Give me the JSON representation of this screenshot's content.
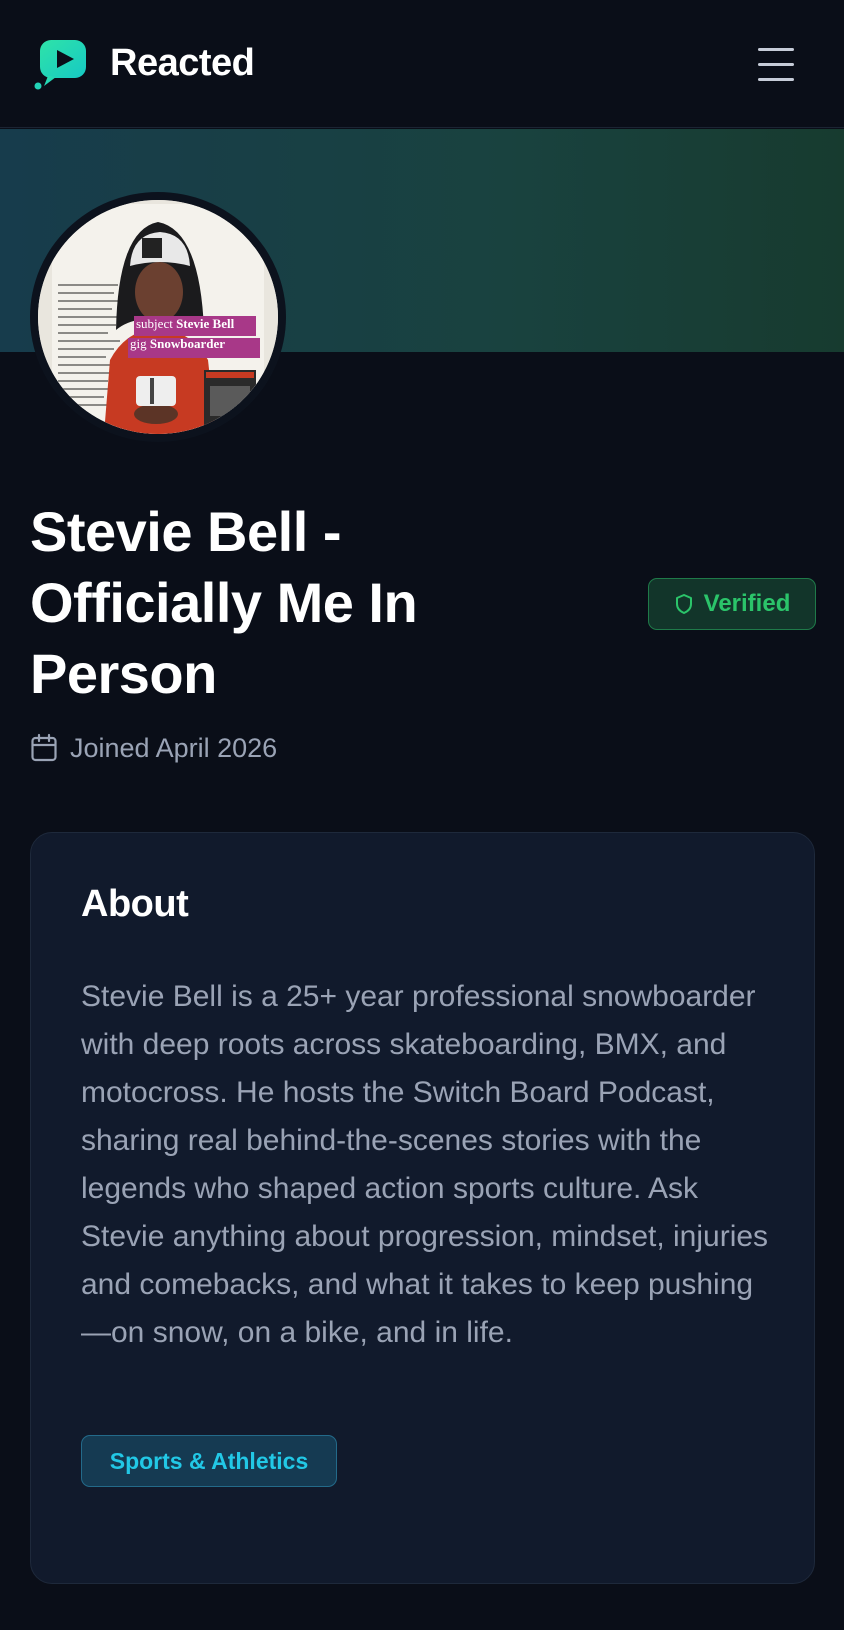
{
  "app": {
    "name": "Reacted",
    "logo_icon": "play-bubble-icon",
    "menu_icon": "hamburger-menu-icon"
  },
  "profile": {
    "name": "Stevie Bell - Officially Me In Person",
    "verified_label": "Verified",
    "verified_icon": "shield-icon",
    "joined_text": "Joined April 2026",
    "joined_icon": "calendar-icon",
    "avatar": {
      "overlay_subject_prefix": "subject",
      "overlay_subject": "Stevie Bell",
      "overlay_gig_prefix": "gig",
      "overlay_gig": "Snowboarder"
    }
  },
  "about": {
    "heading": "About",
    "bio": "Stevie Bell is a 25+ year professional snowboarder with deep roots across skateboarding, BMX, and motocross. He hosts the Switch Board Podcast, sharing real behind-the-scenes stories with the legends who shaped action sports culture. Ask Stevie anything about progression, mindset, injuries and comebacks, and what it takes to keep pushing—on snow, on a bike, and in life.",
    "tags": [
      "Sports & Athletics"
    ]
  },
  "colors": {
    "background": "#0a0e18",
    "card": "#111a2c",
    "brand_teal": "#19d3b0",
    "verified_green": "#2bc46a",
    "tag_cyan": "#22c8e6",
    "muted_text": "#9aa3b5"
  }
}
